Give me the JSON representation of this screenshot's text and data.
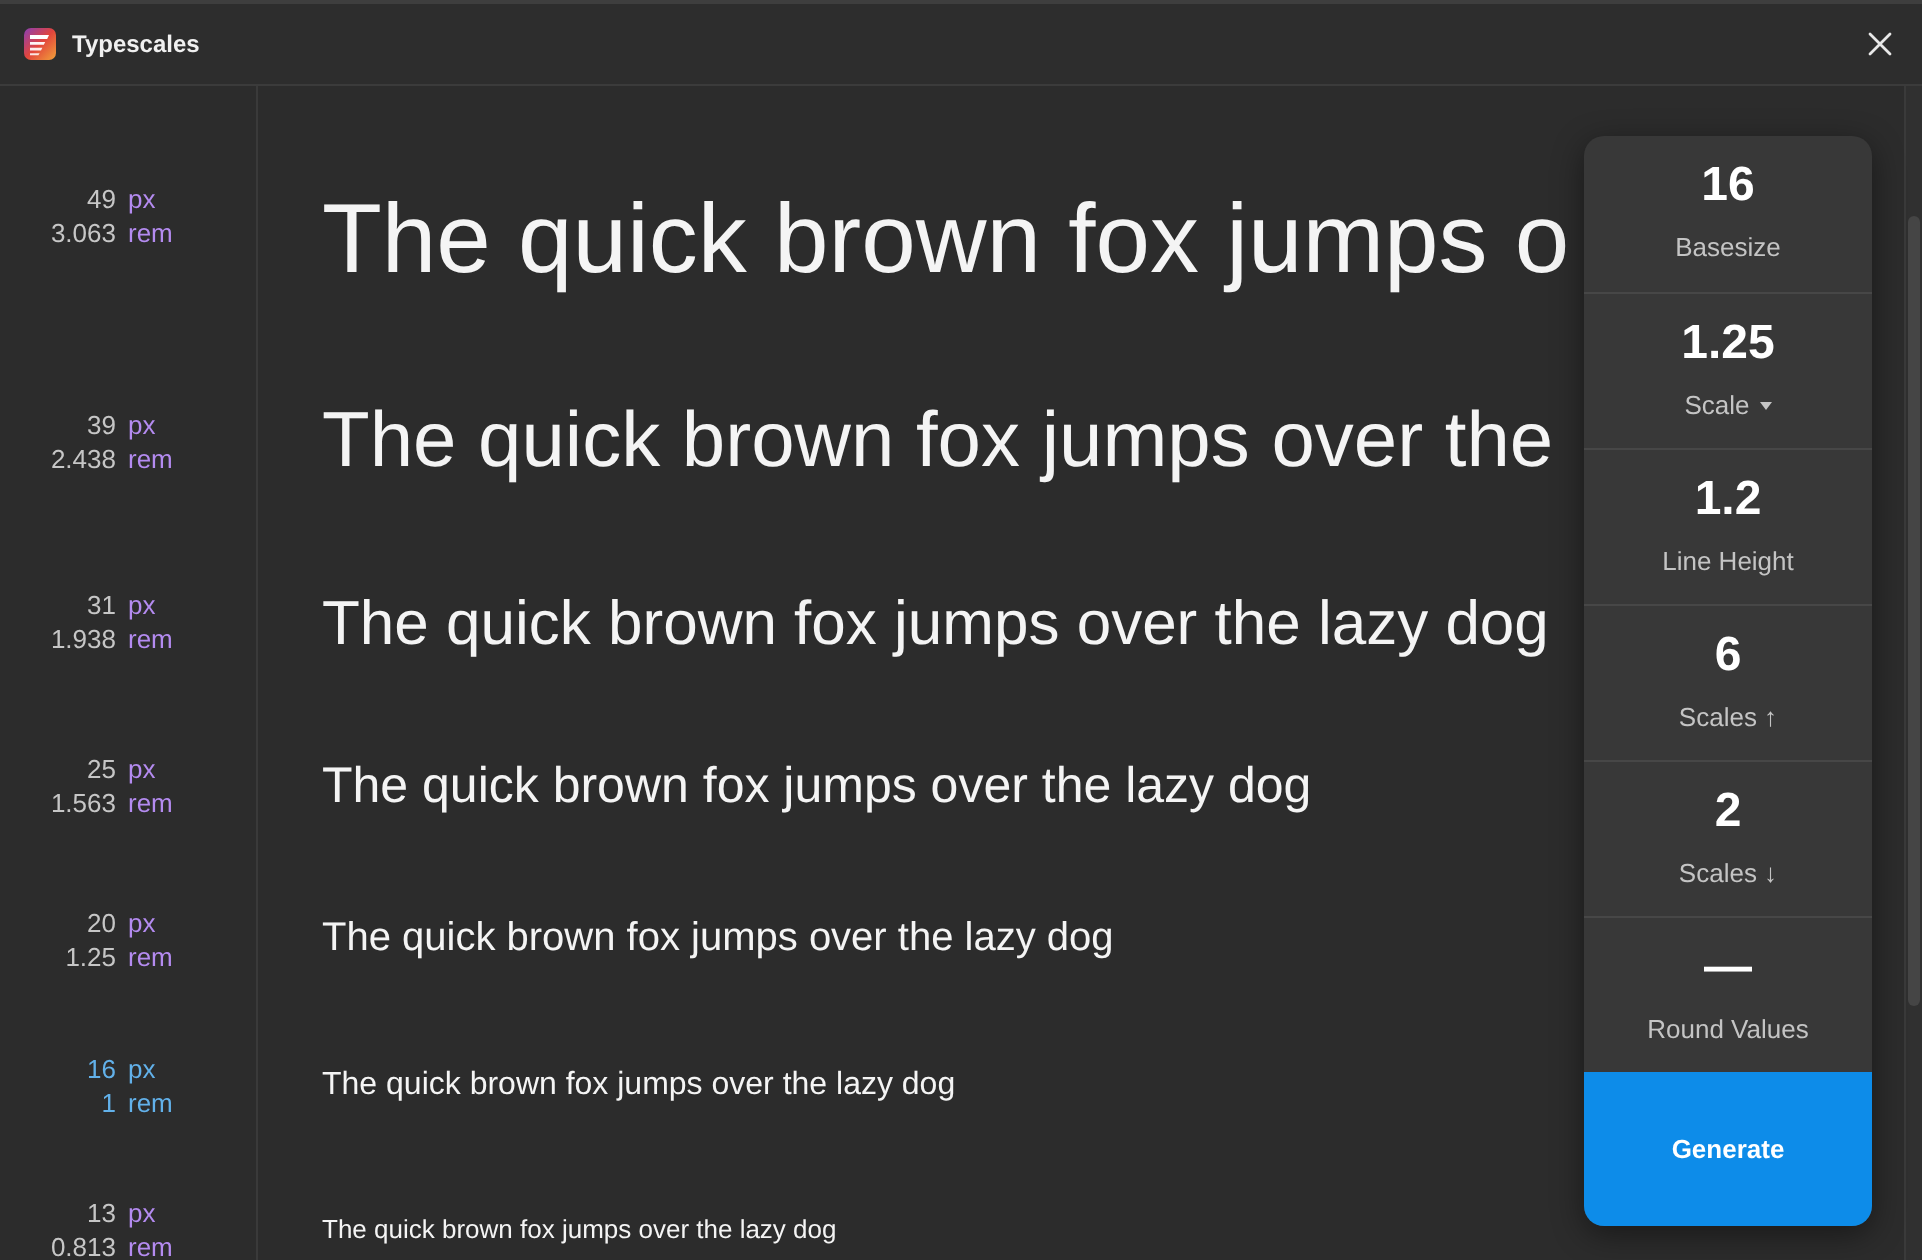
{
  "window": {
    "title": "Typescales"
  },
  "scale_rows": [
    {
      "px": "49",
      "px_unit": "px",
      "rem": "3.063",
      "rem_unit": "rem",
      "sample": "The quick brown fox jumps o",
      "base": false
    },
    {
      "px": "39",
      "px_unit": "px",
      "rem": "2.438",
      "rem_unit": "rem",
      "sample": "The quick brown fox jumps over the",
      "base": false
    },
    {
      "px": "31",
      "px_unit": "px",
      "rem": "1.938",
      "rem_unit": "rem",
      "sample": "The quick brown fox jumps over the lazy dog",
      "base": false
    },
    {
      "px": "25",
      "px_unit": "px",
      "rem": "1.563",
      "rem_unit": "rem",
      "sample": "The quick brown fox jumps over the lazy dog",
      "base": false
    },
    {
      "px": "20",
      "px_unit": "px",
      "rem": "1.25",
      "rem_unit": "rem",
      "sample": "The quick brown fox jumps over the lazy dog",
      "base": false
    },
    {
      "px": "16",
      "px_unit": "px",
      "rem": "1",
      "rem_unit": "rem",
      "sample": "The quick brown fox jumps over the lazy dog",
      "base": true
    },
    {
      "px": "13",
      "px_unit": "px",
      "rem": "0.813",
      "rem_unit": "rem",
      "sample": "The quick brown fox jumps over the lazy dog",
      "base": false
    }
  ],
  "settings_panel": {
    "settings": [
      {
        "value": "16",
        "label": "Basesize",
        "dropdown": false
      },
      {
        "value": "1.25",
        "label": "Scale",
        "dropdown": true
      },
      {
        "value": "1.2",
        "label": "Line Height",
        "dropdown": false
      },
      {
        "value": "6",
        "label": "Scales ↑",
        "dropdown": false
      },
      {
        "value": "2",
        "label": "Scales ↓",
        "dropdown": false
      },
      {
        "value": "—",
        "label": "Round Values",
        "dropdown": false
      }
    ],
    "generate_button": "Generate"
  }
}
